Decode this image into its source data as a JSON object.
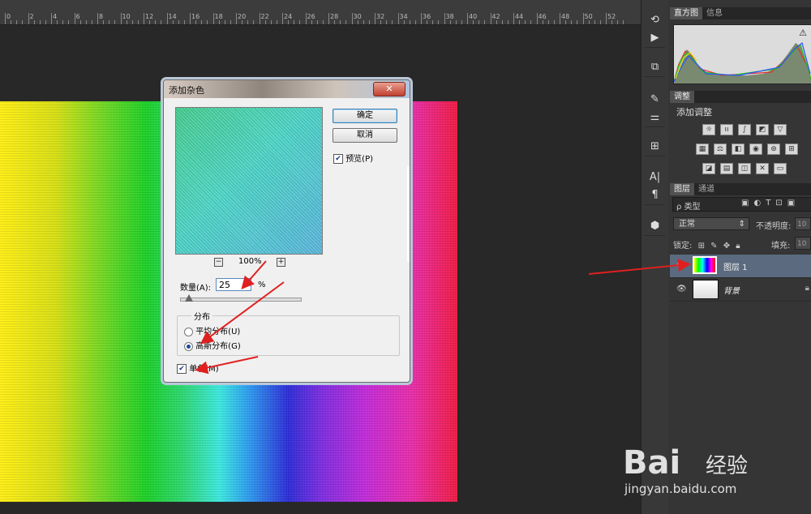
{
  "ruler": {
    "ticks": [
      "0",
      "2",
      "4",
      "6",
      "8",
      "10",
      "12",
      "14",
      "16",
      "18",
      "20",
      "22",
      "24",
      "26",
      "28",
      "30",
      "32",
      "34",
      "36",
      "38",
      "40",
      "42",
      "44",
      "46",
      "48",
      "50",
      "52"
    ]
  },
  "dialog": {
    "title": "添加杂色",
    "close_label": "✕",
    "ok_label": "确定",
    "cancel_label": "取消",
    "preview_label": "预览(P)",
    "preview_checked": true,
    "zoom_out": "−",
    "zoom_in": "+",
    "zoom": "100%",
    "amount_label": "数量(A):",
    "amount_value": "25",
    "amount_unit": "%",
    "distribution_label": "分布",
    "uniform_label": "平均分布(U)",
    "gaussian_label": "高斯分布(G)",
    "selected_distribution": "gaussian",
    "monochrome_label": "单色(M)",
    "monochrome_checked": true
  },
  "panels": {
    "histogram_tab": "直方图",
    "info_tab": "信息",
    "hist_warning": "⚠",
    "adjustments_tab": "调整",
    "add_adjustment": "添加调整",
    "layers_tab": "图层",
    "channels_tab": "通道",
    "filter_kind": "ρ 类型",
    "filter_icons": [
      "▣",
      "◐",
      "T",
      "⊡",
      "▣"
    ],
    "blend_mode": "正常",
    "opacity_label": "不透明度:",
    "opacity_value": "10",
    "lock_label": "锁定:",
    "fill_label": "填充:",
    "fill_value": "10",
    "layers": [
      {
        "name": "图层 1",
        "visible": true,
        "selected": true,
        "locked": false
      },
      {
        "name": "背景",
        "visible": true,
        "selected": false,
        "locked": true
      }
    ]
  },
  "watermark": {
    "brand": "Bai",
    "sub": "经验",
    "url": "jingyan.baidu.com"
  },
  "colors": {
    "app_bg": "#282828",
    "panel_bg": "#353535",
    "selected_layer": "#5b6a7e",
    "arrow": "#e02020"
  }
}
